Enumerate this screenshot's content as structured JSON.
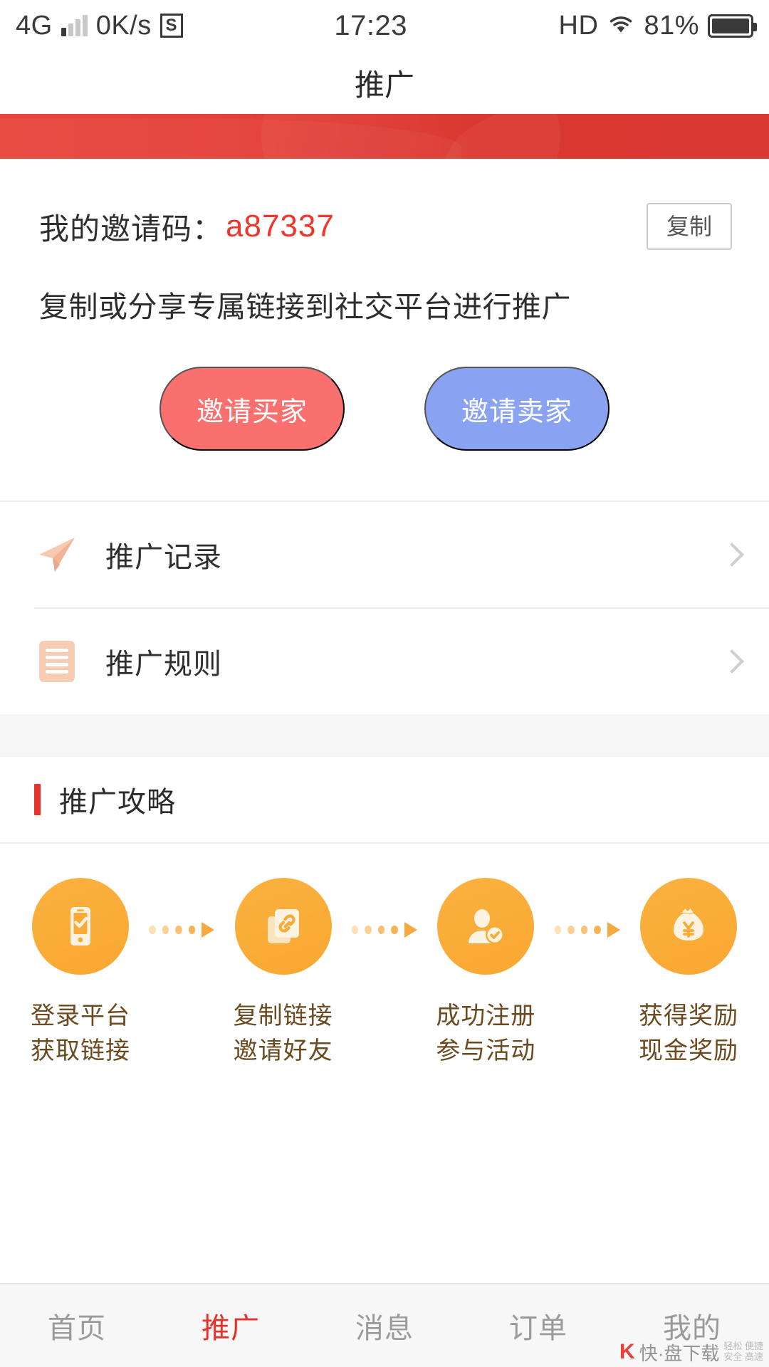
{
  "status_bar": {
    "network_type": "4G",
    "speed": "0K/s",
    "s_badge": "S",
    "time": "17:23",
    "hd": "HD",
    "battery_percent": "81%",
    "wifi_icon": "wifi-icon",
    "battery_icon": "battery-icon",
    "signal_icon": "signal-bars-icon"
  },
  "header": {
    "title": "推广"
  },
  "invite_card": {
    "code_label": "我的邀请码：",
    "code_value": "a87337",
    "copy_label": "复制",
    "subtitle": "复制或分享专属链接到社交平台进行推广",
    "buyer_button": "邀请买家",
    "seller_button": "邀请卖家",
    "buyer_color": "#f9706e",
    "seller_color": "#8aa2f2",
    "code_color": "#f0352c"
  },
  "list": {
    "items": [
      {
        "label": "推广记录",
        "icon": "paper-plane-icon"
      },
      {
        "label": "推广规则",
        "icon": "rules-document-icon"
      }
    ]
  },
  "guide": {
    "section_title": "推广攻略",
    "accent_color": "#e8312a",
    "steps": [
      {
        "icon": "phone-check-icon",
        "line1": "登录平台",
        "line2": "获取链接"
      },
      {
        "icon": "copy-link-icon",
        "line1": "复制链接",
        "line2": "邀请好友"
      },
      {
        "icon": "user-verified-icon",
        "line1": "成功注册",
        "line2": "参与活动"
      },
      {
        "icon": "money-bag-icon",
        "line1": "获得奖励",
        "line2": "现金奖励"
      }
    ]
  },
  "tabbar": {
    "items": [
      {
        "label": "首页",
        "active": false
      },
      {
        "label": "推广",
        "active": true
      },
      {
        "label": "消息",
        "active": false
      },
      {
        "label": "订单",
        "active": false
      },
      {
        "label": "我的",
        "active": false
      }
    ],
    "active_color": "#e8312a"
  },
  "watermark": {
    "letter": "K",
    "text": "快·盘下载",
    "sub1": "轻松 便捷",
    "sub2": "安全 高速"
  }
}
